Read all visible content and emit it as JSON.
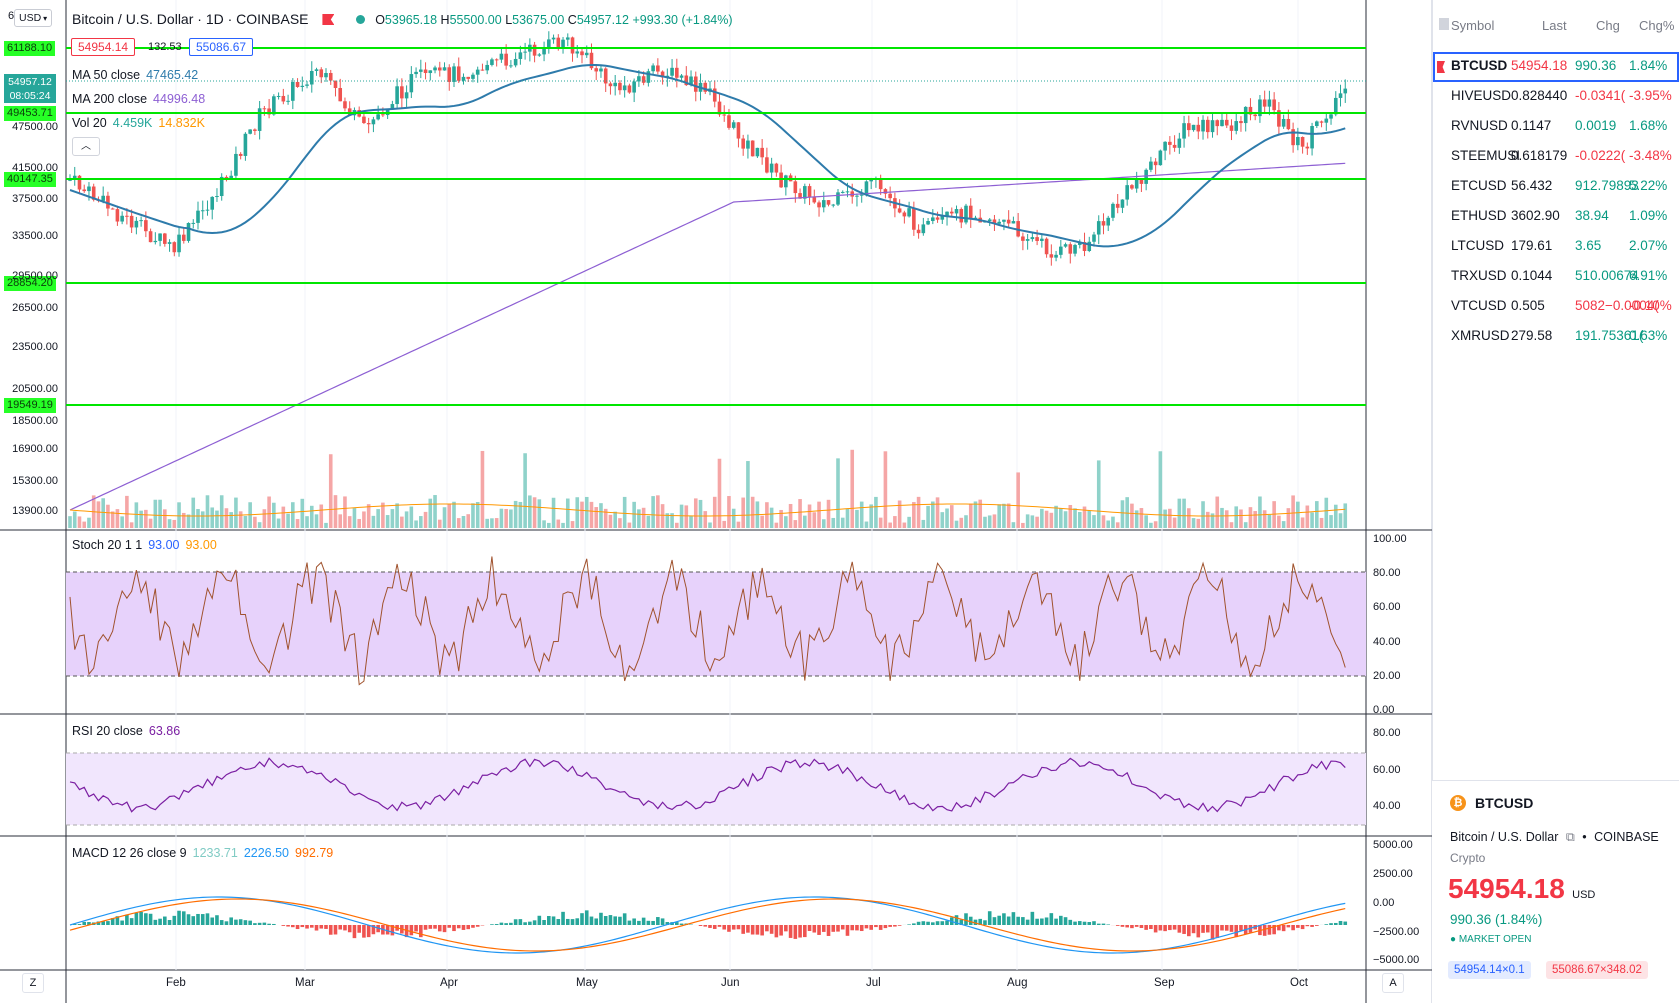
{
  "header": {
    "top_left_tag": "6",
    "currency_btn": "USD",
    "title": "Bitcoin / U.S. Dollar · 1D · COINBASE",
    "ohlc": {
      "o_label": "O",
      "o": "53965.18",
      "h_label": "H",
      "h": "55500.00",
      "l_label": "L",
      "l": "53675.00",
      "c_label": "C",
      "c": "54957.12",
      "change": "+993.30 (+1.84%)"
    },
    "sell_price": "54954.14",
    "spread": "132.53",
    "buy_price": "55086.67",
    "indicators": [
      {
        "name": "MA 50 close",
        "value": "47465.42",
        "color": "#2e7bab"
      },
      {
        "name": "MA 200 close",
        "value": "44996.48",
        "color": "#7c4dbd"
      },
      {
        "name": "Vol 20",
        "value": "4.459K",
        "value2": "14.832K",
        "color": "#26a69a",
        "color2": "#ff9800"
      }
    ],
    "last_price_tag": "54957.12",
    "countdown_tag": "08:05:24"
  },
  "price_axis": [
    "47500.00",
    "41500.00",
    "37500.00",
    "33500.00",
    "29500.00",
    "26500.00",
    "23500.00",
    "20500.00",
    "18500.00",
    "16900.00",
    "15300.00",
    "13900.00"
  ],
  "horizontal_levels": [
    {
      "label": "61188.10"
    },
    {
      "label": "49453.71"
    },
    {
      "label": "40147.35"
    },
    {
      "label": "28854.20"
    },
    {
      "label": "19549.19"
    }
  ],
  "stoch": {
    "name": "Stoch 20 1 1",
    "k": "93.00",
    "d": "93.00",
    "axis": [
      "100.00",
      "80.00",
      "60.00",
      "40.00",
      "20.00",
      "0.00"
    ]
  },
  "rsi": {
    "name": "RSI 20 close",
    "value": "63.86",
    "axis": [
      "80.00",
      "60.00",
      "40.00"
    ]
  },
  "macd": {
    "name": "MACD 12 26 close 9",
    "hist": "1233.71",
    "macd": "2226.50",
    "signal": "992.79",
    "axis": [
      "5000.00",
      "2500.00",
      "0.00",
      "−2500.00",
      "−5000.00"
    ]
  },
  "time_axis": [
    "Feb",
    "Mar",
    "Apr",
    "May",
    "Jun",
    "Jul",
    "Aug",
    "Sep",
    "Oct"
  ],
  "bottom_buttons": {
    "left": "Z",
    "right": "A"
  },
  "colors": {
    "up": "#26a69a",
    "down": "#ef5350",
    "level": "#00e600",
    "ma50": "#2e7bab",
    "ma200": "#8d5fd3",
    "stoch_band": "#e7d2fb",
    "rsi_band": "#f1e6fd"
  },
  "watchlist": {
    "headers": {
      "symbol": "Symbol",
      "last": "Last",
      "chg": "Chg",
      "chgp": "Chg%"
    },
    "rows": [
      {
        "symbol": "BTCUSD",
        "last": "54954.18",
        "chg": "990.36",
        "chgp": "1.84%",
        "dir": "up"
      },
      {
        "symbol": "HIVEUSD",
        "last": "0.828440",
        "chg": "-0.0341(",
        "chgp": "-3.95%",
        "dir": "down"
      },
      {
        "symbol": "RVNUSD",
        "last": "0.1147",
        "chg": "0.0019",
        "chgp": "1.68%",
        "dir": "up"
      },
      {
        "symbol": "STEEMUSI",
        "last": "0.618179",
        "chg": "-0.0222(",
        "chgp": "-3.48%",
        "dir": "down"
      },
      {
        "symbol": "ETCUSD",
        "last": "56.432",
        "chg": "912.79893",
        "chgp": "5.22%",
        "dir": "up"
      },
      {
        "symbol": "ETHUSD",
        "last": "3602.90",
        "chg": "38.94",
        "chgp": "1.09%",
        "dir": "up"
      },
      {
        "symbol": "LTCUSD",
        "last": "179.61",
        "chg": "3.65",
        "chgp": "2.07%",
        "dir": "up"
      },
      {
        "symbol": "TRXUSD",
        "last": "0.1044",
        "chg": "510.00674",
        "chgp": "6.91%",
        "dir": "up"
      },
      {
        "symbol": "VTCUSD",
        "last": "0.505",
        "chg": "5082−0.0004(",
        "chgp": "-0.10%",
        "dir": "down"
      },
      {
        "symbol": "XMRUSD",
        "last": "279.58",
        "chg": "191.75361(",
        "chgp": "0.63%",
        "dir": "up"
      }
    ]
  },
  "details": {
    "symbol": "BTCUSD",
    "full_name": "Bitcoin / U.S. Dollar",
    "exchange": "COINBASE",
    "type": "Crypto",
    "price": "54954.18",
    "currency": "USD",
    "change": "990.36 (1.84%)",
    "market_status": "MARKET OPEN",
    "bid": "54954.14×0.1",
    "ask": "55086.67×348.02"
  }
}
